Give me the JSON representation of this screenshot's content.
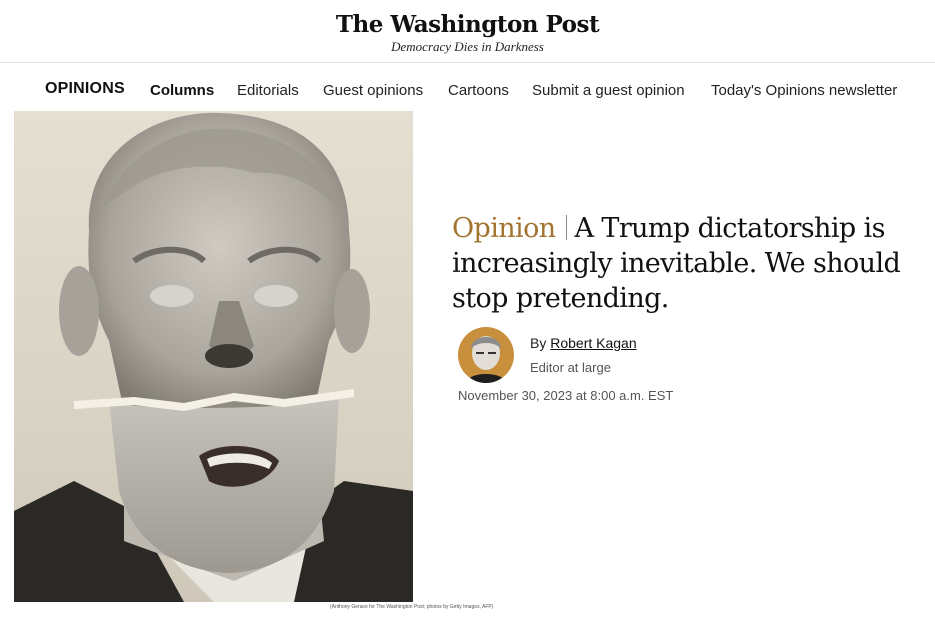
{
  "masthead": {
    "logo": "The Washington Post",
    "tagline": "Democracy Dies in Darkness"
  },
  "nav": {
    "brand": "OPINIONS",
    "items": [
      {
        "label": "Columns",
        "active": true
      },
      {
        "label": "Editorials"
      },
      {
        "label": "Guest opinions"
      },
      {
        "label": "Cartoons"
      },
      {
        "label": "Submit a guest opinion"
      },
      {
        "label": "Today's Opinions newsletter"
      }
    ]
  },
  "article": {
    "kicker": "Opinion",
    "headline": "A Trump dictatorship is increasingly inevitable. We should stop pretending.",
    "author_prefix": "By",
    "author": "Robert Kagan",
    "author_role": "Editor at large",
    "date": "November 30, 2023 at 8:00 a.m. EST",
    "photo_credit": "(Anthony Gerace for The Washington Post; photos by Getty Images, AFP)"
  },
  "colors": {
    "kicker": "#a27431",
    "avatar_bg": "#c8903c"
  }
}
